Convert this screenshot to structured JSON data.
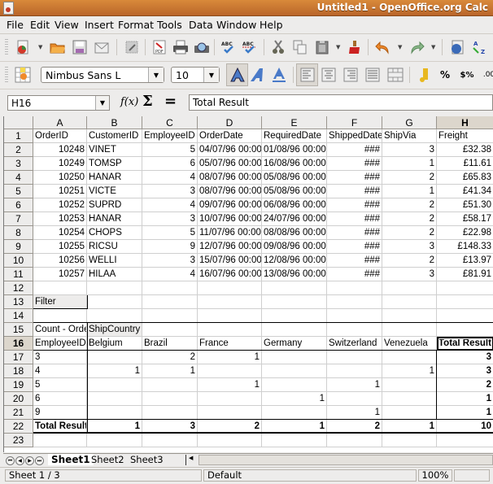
{
  "window": {
    "title": "Untitled1 - OpenOffice.org Calc"
  },
  "menu": [
    "File",
    "Edit",
    "View",
    "Insert",
    "Format",
    "Tools",
    "Data",
    "Window",
    "Help"
  ],
  "toolbar1": {
    "icons": [
      "new-document-icon",
      "open-folder-icon",
      "save-icon",
      "email-icon",
      "edit-file-icon",
      "export-pdf-icon",
      "print-icon",
      "page-preview-icon",
      "spellcheck-icon",
      "autospellcheck-icon",
      "cut-icon",
      "copy-icon",
      "paste-icon",
      "clone-formatting-icon",
      "undo-icon",
      "redo-icon",
      "hyperlink-icon",
      "sort-ascending-icon"
    ]
  },
  "toolbar2": {
    "font_name": "Nimbus Sans L",
    "font_size": "10",
    "icons": [
      "styles-icon",
      "bold-icon",
      "italic-icon",
      "underline-icon",
      "align-left-icon",
      "align-center-icon",
      "align-right-icon",
      "justify-icon",
      "merge-cells-icon",
      "currency-icon",
      "percent-icon",
      "number-format-icon",
      "add-decimal-icon"
    ]
  },
  "formula_bar": {
    "cell_ref": "H16",
    "fx_label": "f(x)",
    "sigma": "Σ",
    "equals": "=",
    "content": "Total Result"
  },
  "columns": [
    "A",
    "B",
    "C",
    "D",
    "E",
    "F",
    "G",
    "H"
  ],
  "active_column": "H",
  "active_row": "16",
  "rows": [
    "1",
    "2",
    "3",
    "4",
    "5",
    "6",
    "7",
    "8",
    "9",
    "10",
    "11",
    "12",
    "13",
    "14",
    "15",
    "16",
    "17",
    "18",
    "19",
    "20",
    "21",
    "22",
    "23"
  ],
  "data_table": {
    "headers": [
      "OrderID",
      "CustomerID",
      "EmployeeID",
      "OrderDate",
      "RequiredDate",
      "ShippedDate",
      "ShipVia",
      "Freight"
    ],
    "rows": [
      [
        "10248",
        "VINET",
        "5",
        "04/07/96 00:00",
        "01/08/96 00:00",
        "###",
        "3",
        "£32.38"
      ],
      [
        "10249",
        "TOMSP",
        "6",
        "05/07/96 00:00",
        "16/08/96 00:00",
        "###",
        "1",
        "£11.61"
      ],
      [
        "10250",
        "HANAR",
        "4",
        "08/07/96 00:00",
        "05/08/96 00:00",
        "###",
        "2",
        "£65.83"
      ],
      [
        "10251",
        "VICTE",
        "3",
        "08/07/96 00:00",
        "05/08/96 00:00",
        "###",
        "1",
        "£41.34"
      ],
      [
        "10252",
        "SUPRD",
        "4",
        "09/07/96 00:00",
        "06/08/96 00:00",
        "###",
        "2",
        "£51.30"
      ],
      [
        "10253",
        "HANAR",
        "3",
        "10/07/96 00:00",
        "24/07/96 00:00",
        "###",
        "2",
        "£58.17"
      ],
      [
        "10254",
        "CHOPS",
        "5",
        "11/07/96 00:00",
        "08/08/96 00:00",
        "###",
        "2",
        "£22.98"
      ],
      [
        "10255",
        "RICSU",
        "9",
        "12/07/96 00:00",
        "09/08/96 00:00",
        "###",
        "3",
        "£148.33"
      ],
      [
        "10256",
        "WELLI",
        "3",
        "15/07/96 00:00",
        "12/08/96 00:00",
        "###",
        "2",
        "£13.97"
      ],
      [
        "10257",
        "HILAA",
        "4",
        "16/07/96 00:00",
        "13/08/96 00:00",
        "###",
        "3",
        "£81.91"
      ]
    ]
  },
  "pivot": {
    "filter_label": "Filter",
    "data_field": "Count - OrderID",
    "column_field": "ShipCountry",
    "row_field": "EmployeeID",
    "countries": [
      "Belgium",
      "Brazil",
      "France",
      "Germany",
      "Switzerland",
      "Venezuela"
    ],
    "total_label": "Total Result",
    "rows": [
      {
        "id": "3",
        "values": [
          "",
          "2",
          "1",
          "",
          "",
          ""
        ],
        "total": "3"
      },
      {
        "id": "4",
        "values": [
          "1",
          "1",
          "",
          "",
          "",
          "1"
        ],
        "total": "3"
      },
      {
        "id": "5",
        "values": [
          "",
          "",
          "1",
          "",
          "1",
          ""
        ],
        "total": "2"
      },
      {
        "id": "6",
        "values": [
          "",
          "",
          "",
          "1",
          "",
          ""
        ],
        "total": "1"
      },
      {
        "id": "9",
        "values": [
          "",
          "",
          "",
          "",
          "1",
          ""
        ],
        "total": "1"
      }
    ],
    "totals": [
      "1",
      "3",
      "2",
      "1",
      "2",
      "1"
    ],
    "grand_total": "10"
  },
  "sheet_tabs": [
    "Sheet1",
    "Sheet2",
    "Sheet3"
  ],
  "active_sheet": "Sheet1",
  "status": {
    "sheet": "Sheet 1 / 3",
    "style": "Default",
    "zoom": "100%"
  }
}
